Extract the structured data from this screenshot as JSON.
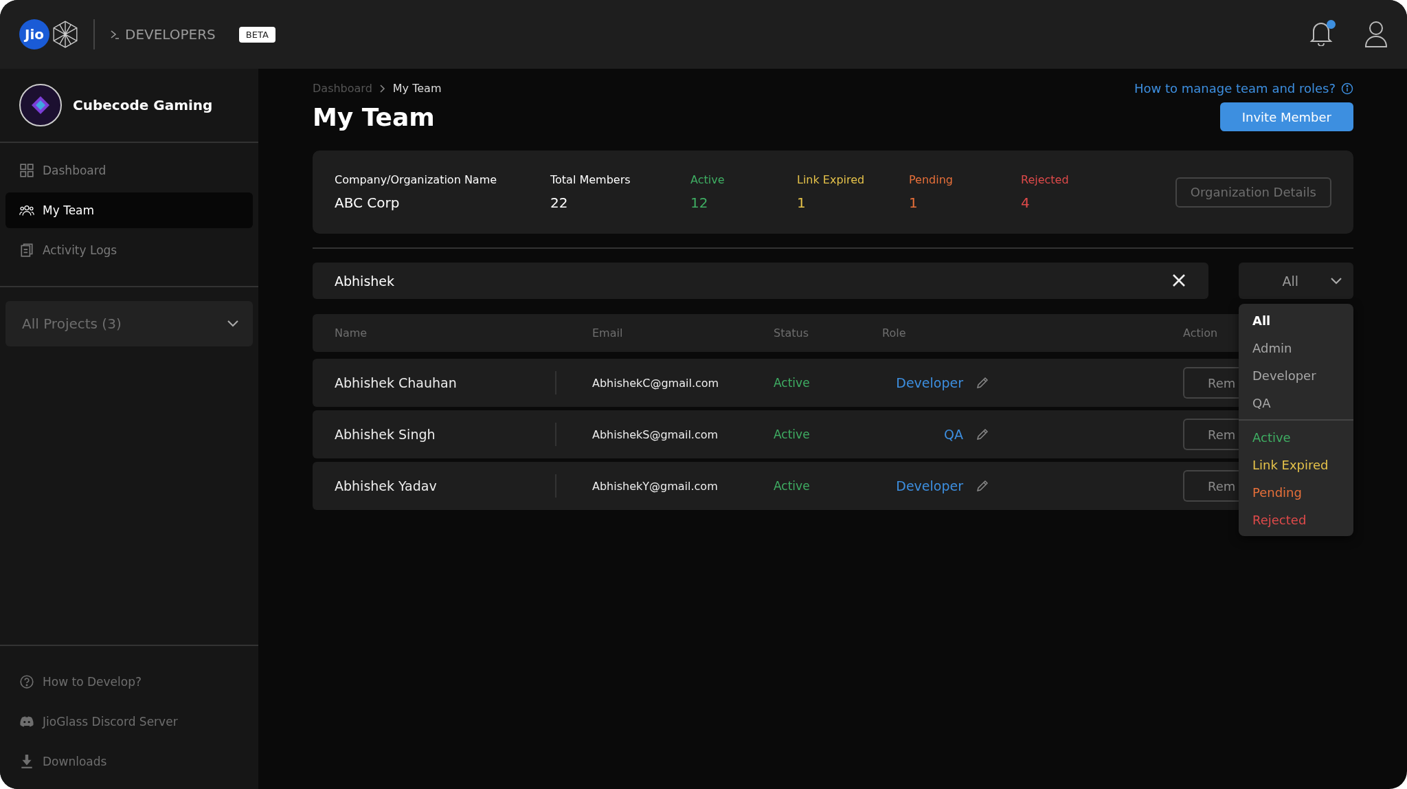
{
  "topbar": {
    "logo_text": "Jio",
    "section": "DEVELOPERS",
    "badge": "BETA",
    "notification_unread": true
  },
  "sidebar": {
    "org_name": "Cubecode Gaming",
    "nav": [
      {
        "label": "Dashboard",
        "selected": false
      },
      {
        "label": "My Team",
        "selected": true
      },
      {
        "label": "Activity Logs",
        "selected": false
      }
    ],
    "projects": {
      "value": "All Projects (3)"
    },
    "footer": [
      {
        "label": "How to Develop?"
      },
      {
        "label": "JioGlass Discord Server"
      },
      {
        "label": "Downloads"
      }
    ]
  },
  "main": {
    "breadcrumb": [
      {
        "label": "Dashboard",
        "selected": false
      },
      {
        "label": "My Team",
        "selected": true
      }
    ],
    "help_link": "How to manage team and roles?",
    "title": "My Team",
    "invite_button": "Invite Member",
    "summary": {
      "org_label": "Company/Organization Name",
      "org_value": "ABC Corp",
      "stats": [
        {
          "label": "Total Members",
          "value": "22",
          "color": "#ffffff"
        },
        {
          "label": "Active",
          "value": "12",
          "color": "#3fae63"
        },
        {
          "label": "Link Expired",
          "value": "1",
          "color": "#e6c34a"
        },
        {
          "label": "Pending",
          "value": "1",
          "color": "#e8703a"
        },
        {
          "label": "Rejected",
          "value": "4",
          "color": "#e04a4a"
        }
      ],
      "details_button": "Organization Details"
    },
    "search": {
      "value": "Abhishek"
    },
    "filter": {
      "value": "All",
      "expanded": true,
      "role_options": [
        {
          "label": "All",
          "selected": true,
          "color": "#ffffff"
        },
        {
          "label": "Admin",
          "selected": false,
          "color": "#a8a8a8"
        },
        {
          "label": "Developer",
          "selected": false,
          "color": "#a8a8a8"
        },
        {
          "label": "QA",
          "selected": false,
          "color": "#a8a8a8"
        }
      ],
      "status_options": [
        {
          "label": "Active",
          "selected": false,
          "color": "#3fae63"
        },
        {
          "label": "Link Expired",
          "selected": false,
          "color": "#e6c34a"
        },
        {
          "label": "Pending",
          "selected": false,
          "color": "#e8703a"
        },
        {
          "label": "Rejected",
          "selected": false,
          "color": "#e04a4a"
        }
      ]
    },
    "table": {
      "columns": [
        "Name",
        "Email",
        "Status",
        "Role",
        "Action"
      ],
      "rows": [
        {
          "name": "Abhishek Chauhan",
          "email": "AbhishekC@gmail.com",
          "status": "Active",
          "role": "Developer",
          "action": "Rem"
        },
        {
          "name": "Abhishek Singh",
          "email": "AbhishekS@gmail.com",
          "status": "Active",
          "role": "QA",
          "action": "Rem"
        },
        {
          "name": "Abhishek Yadav",
          "email": "AbhishekY@gmail.com",
          "status": "Active",
          "role": "Developer",
          "action": "Rem"
        }
      ]
    }
  }
}
